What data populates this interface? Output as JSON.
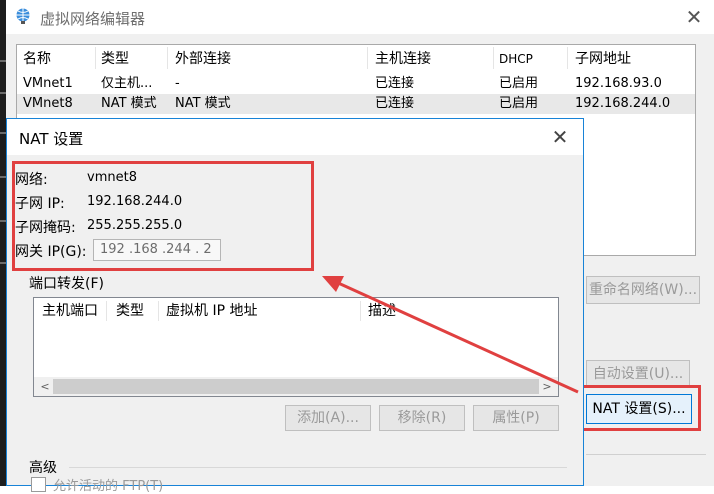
{
  "main_window": {
    "title": "虚拟网络编辑器",
    "close_glyph": "✕",
    "table": {
      "headers": [
        "名称",
        "类型",
        "外部连接",
        "主机连接",
        "DHCP",
        "子网地址"
      ],
      "rows": [
        {
          "name": "VMnet1",
          "type": "仅主机...",
          "external": "-",
          "host": "已连接",
          "dhcp": "已启用",
          "subnet": "192.168.93.0"
        },
        {
          "name": "VMnet8",
          "type": "NAT 模式",
          "external": "NAT 模式",
          "host": "已连接",
          "dhcp": "已启用",
          "subnet": "192.168.244.0"
        }
      ]
    },
    "buttons": {
      "rename": "重命名网络(W)...",
      "auto": "自动设置(U)...",
      "nat": "NAT 设置(S)..."
    }
  },
  "nat_dialog": {
    "title": "NAT 设置",
    "close_glyph": "✕",
    "network_label": "网络:",
    "network_value": "vmnet8",
    "subnet_ip_label": "子网 IP:",
    "subnet_ip_value": "192.168.244.0",
    "subnet_mask_label": "子网掩码:",
    "subnet_mask_value": "255.255.255.0",
    "gateway_label": "网关 IP(G):",
    "gateway_value": "192 .168 .244 . 2",
    "port_forwarding_label": "端口转发(F)",
    "pf_headers": [
      "主机端口",
      "类型",
      "虚拟机 IP 地址",
      "描述"
    ],
    "scroll_left": "<",
    "scroll_right": ">",
    "buttons": {
      "add": "添加(A)...",
      "remove": "移除(R)",
      "properties": "属性(P)"
    },
    "advanced_label": "高级",
    "advanced_option": "允许活动的 FTP(T)"
  },
  "colors": {
    "annotation": "#e04040",
    "dialog_border": "#1883d7"
  }
}
